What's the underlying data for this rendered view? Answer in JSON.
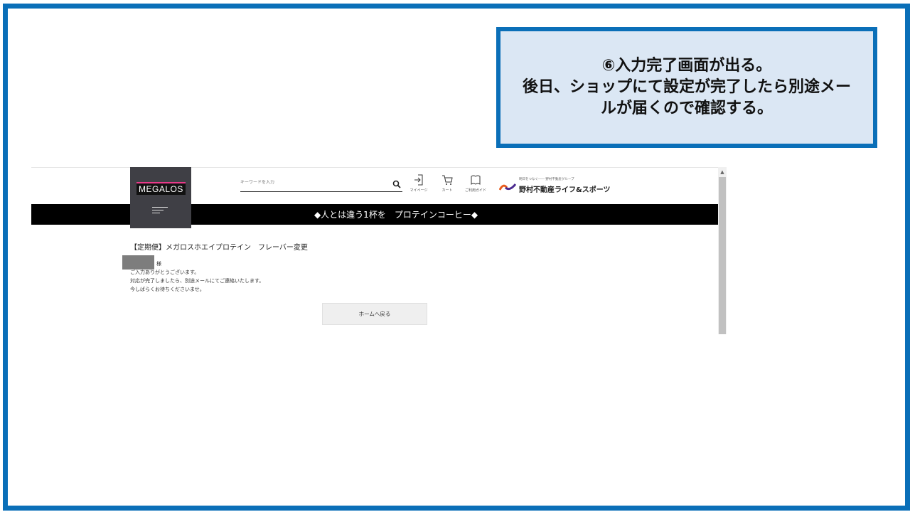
{
  "slide": {
    "frame_color": "#0a6fb8",
    "callout": {
      "lines": [
        "⑥入力完了画面が出る。",
        "後日、ショップにて設定が完了したら別途メー",
        "ルが届くので確認する。"
      ],
      "background": "#dbe7f4",
      "border_color": "#0a6fb8"
    }
  },
  "site": {
    "logo_text": "MEGALOS",
    "search": {
      "placeholder": "キーワードを入力",
      "value": ""
    },
    "header_icons": [
      {
        "icon": "login-icon",
        "label": "マイページ"
      },
      {
        "icon": "cart-icon",
        "label": "カート"
      },
      {
        "icon": "guide-icon",
        "label": "ご利用ガイド"
      }
    ],
    "brand": {
      "tagline": "明日をつなぐ―― 野村不動産グループ",
      "name": "野村不動産ライフ&スポーツ"
    },
    "banner_text": "◆人とは違う1杯を　プロテインコーヒー◆",
    "page_title": "【定期便】メガロスホエイプロテイン　フレーバー変更",
    "honorific": "様",
    "messages": [
      "ご入力ありがとうございます。",
      "対応が完了しましたら、別途メールにてご連絡いたします。",
      "今しばらくお待ちくださいませ。"
    ],
    "home_button_label": "ホームへ戻る"
  }
}
